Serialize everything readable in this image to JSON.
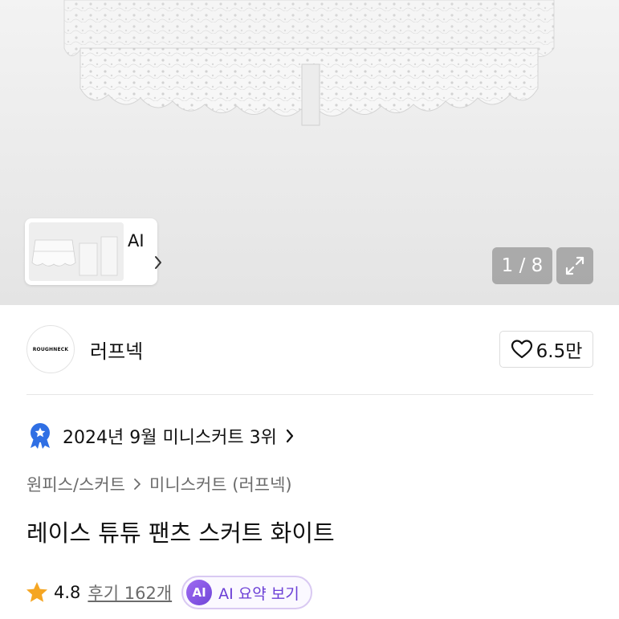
{
  "gallery": {
    "ai_thumb_label": "AI",
    "page_indicator": "1 / 8"
  },
  "brand": {
    "logo_text": "ROUGHNECK",
    "name": "러프넥",
    "like_count": "6.5만"
  },
  "ranking": {
    "text": "2024년 9월 미니스커트 3위"
  },
  "breadcrumb": {
    "category": "원피스/스커트",
    "subcategory": "미니스커트 (러프넥)"
  },
  "product": {
    "title": "레이스 튜튜 팬츠 스커트 화이트"
  },
  "rating": {
    "score": "4.8",
    "reviews": "후기 162개",
    "ai_badge": "AI",
    "ai_summary_label": "AI 요약 보기"
  },
  "colors": {
    "accent_purple": "#6b3fd6",
    "rank_badge_blue": "#2f6fe4",
    "star_orange": "#f5a623"
  }
}
